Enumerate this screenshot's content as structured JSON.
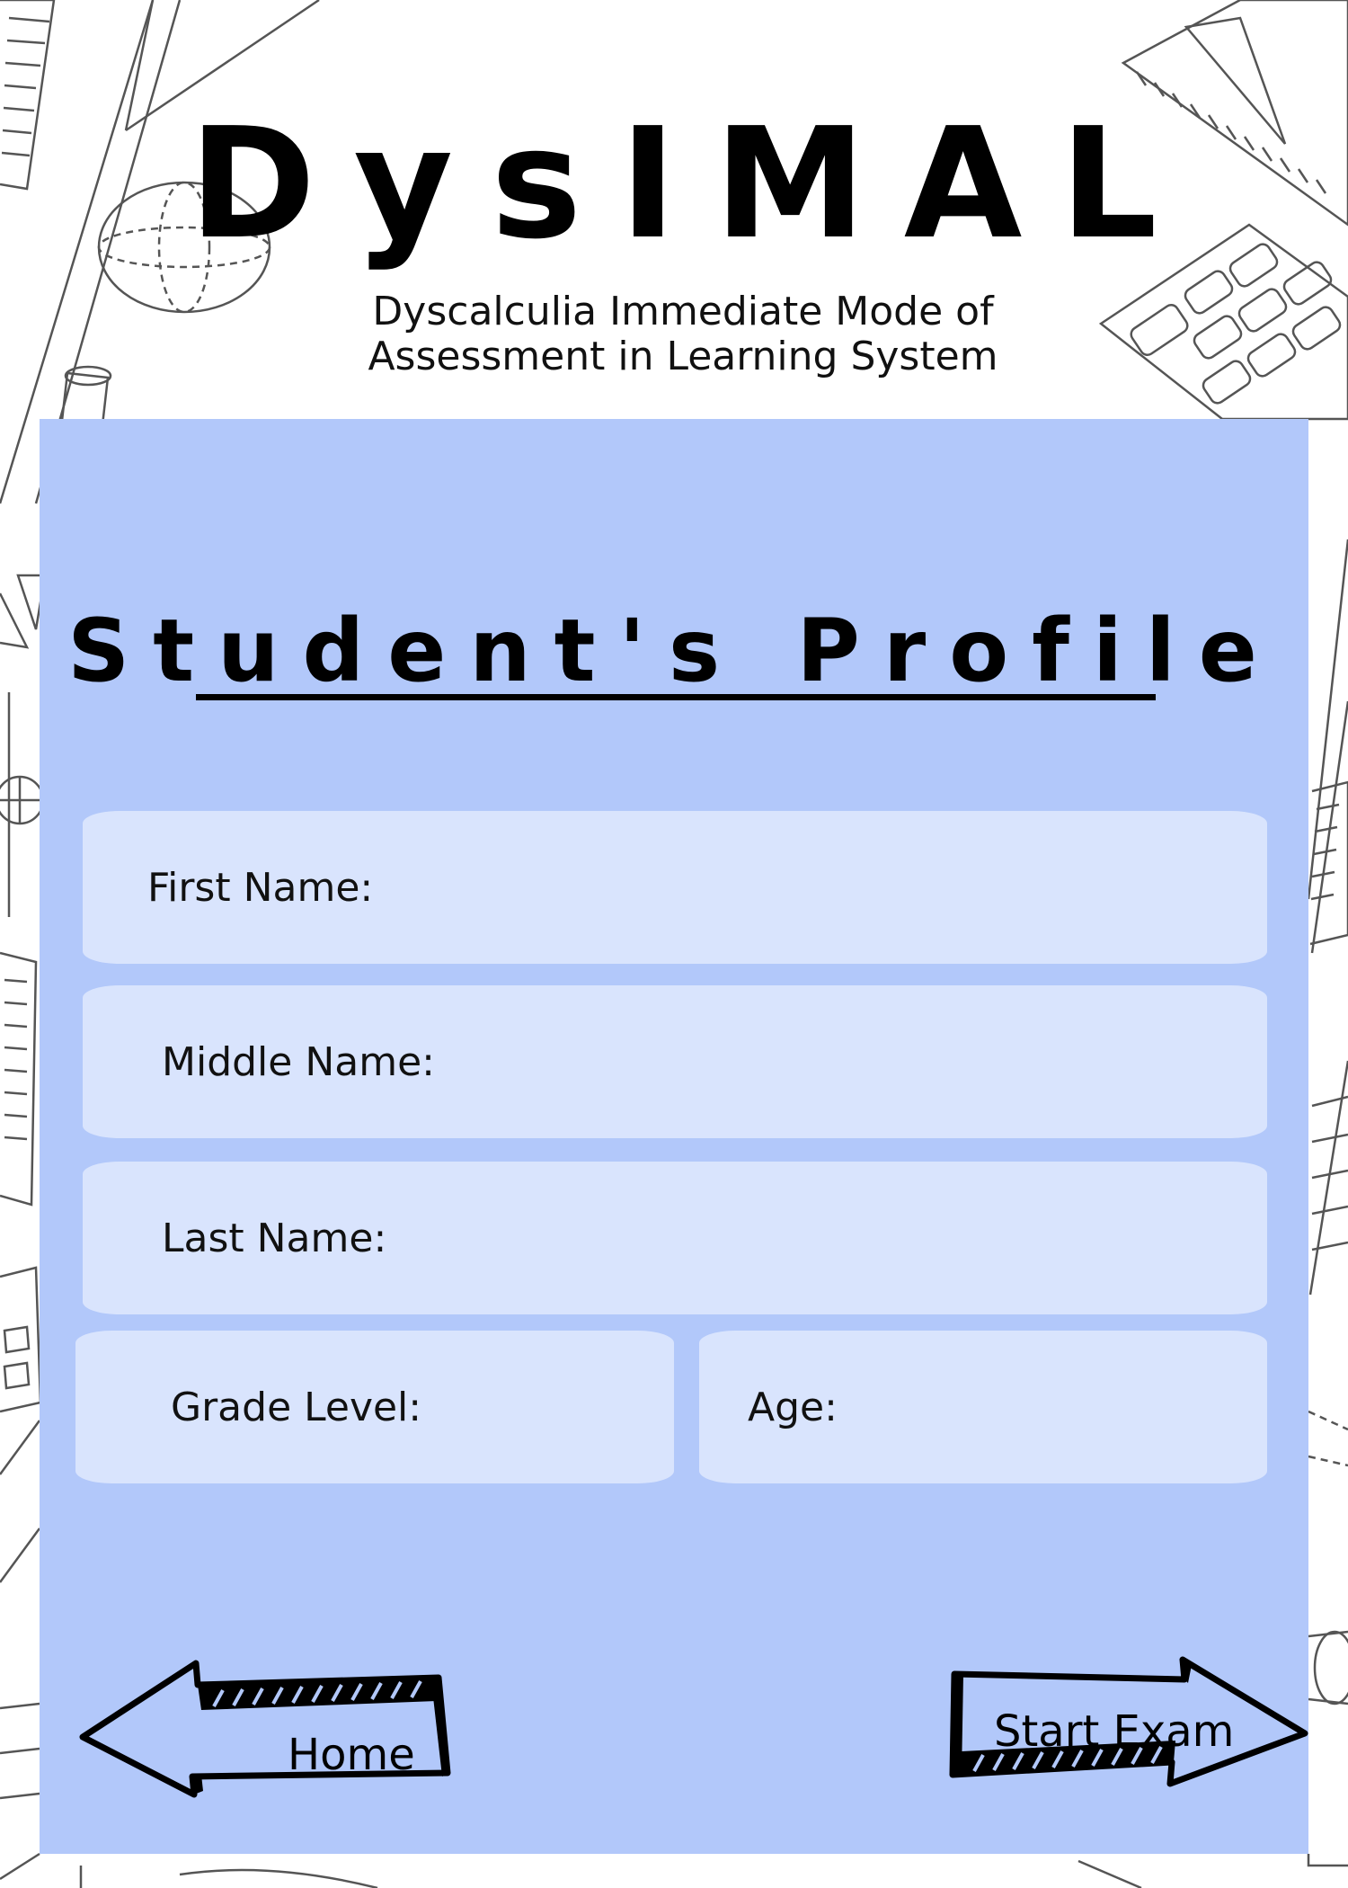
{
  "app": {
    "title": "DysIMAL",
    "subtitle_line1": "Dyscalculia Immediate Mode of",
    "subtitle_line2": "Assessment in Learning System"
  },
  "profile": {
    "heading": "Student's Profile",
    "fields": {
      "first_name": "First Name:",
      "middle_name": "Middle Name:",
      "last_name": "Last Name:",
      "grade_level": "Grade Level:",
      "age": "Age:"
    }
  },
  "navigation": {
    "home_label": "Home",
    "start_exam_label": "Start Exam"
  },
  "colors": {
    "panel": "#b2c8fa",
    "field": "#d9e4fd",
    "background": "#ffffff",
    "doodle_lines": "#555555"
  },
  "icons": {
    "background_doodles": [
      "ruler-icon",
      "triangle-ruler-icon",
      "globe-sketch-icon",
      "calculator-icon",
      "pencil-icon",
      "protractor-icon"
    ],
    "home_arrow": "left-arrow-icon",
    "start_arrow": "right-arrow-icon"
  }
}
